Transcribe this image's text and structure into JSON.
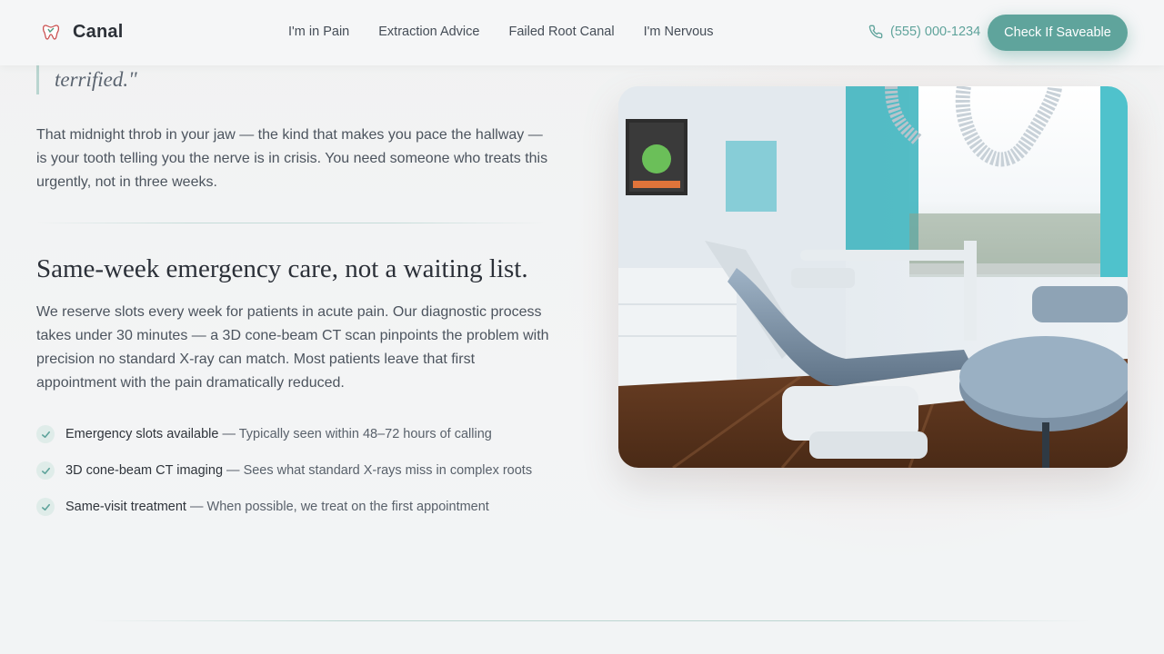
{
  "brand": {
    "name": "Canal",
    "logo_icon": "tooth-logo-icon",
    "accent_color": "#5fa49c"
  },
  "nav": {
    "items": [
      {
        "label": "I'm in Pain"
      },
      {
        "label": "Extraction Advice"
      },
      {
        "label": "Failed Root Canal"
      },
      {
        "label": "I'm Nervous"
      }
    ]
  },
  "contact": {
    "phone_icon": "phone-icon",
    "phone": "(555) 000-1234",
    "cta_label": "Check If Saveable"
  },
  "main": {
    "quote_tail": "terrified.\"",
    "intro": "That midnight throb in your jaw — the kind that makes you pace the hallway — is your tooth telling you the nerve is in crisis. You need someone who treats this urgently, not in three weeks.",
    "heading": "Same-week emergency care, not a waiting list.",
    "body": "We reserve slots every week for patients in acute pain. Our diagnostic process takes under 30 minutes — a 3D cone-beam CT scan pinpoints the problem with precision no standard X-ray can match. Most patients leave that first appointment with the pain dramatically reduced.",
    "features": [
      {
        "icon": "check-icon",
        "title": "Emergency slots available",
        "desc": " — Typically seen within 48–72 hours of calling"
      },
      {
        "icon": "check-icon",
        "title": "3D cone-beam CT imaging",
        "desc": " — Sees what standard X-rays miss in complex roots"
      },
      {
        "icon": "check-icon",
        "title": "Same-visit treatment",
        "desc": " — When possible, we treat on the first appointment"
      }
    ]
  },
  "photo": {
    "subject": "dental-operatory-photo"
  }
}
